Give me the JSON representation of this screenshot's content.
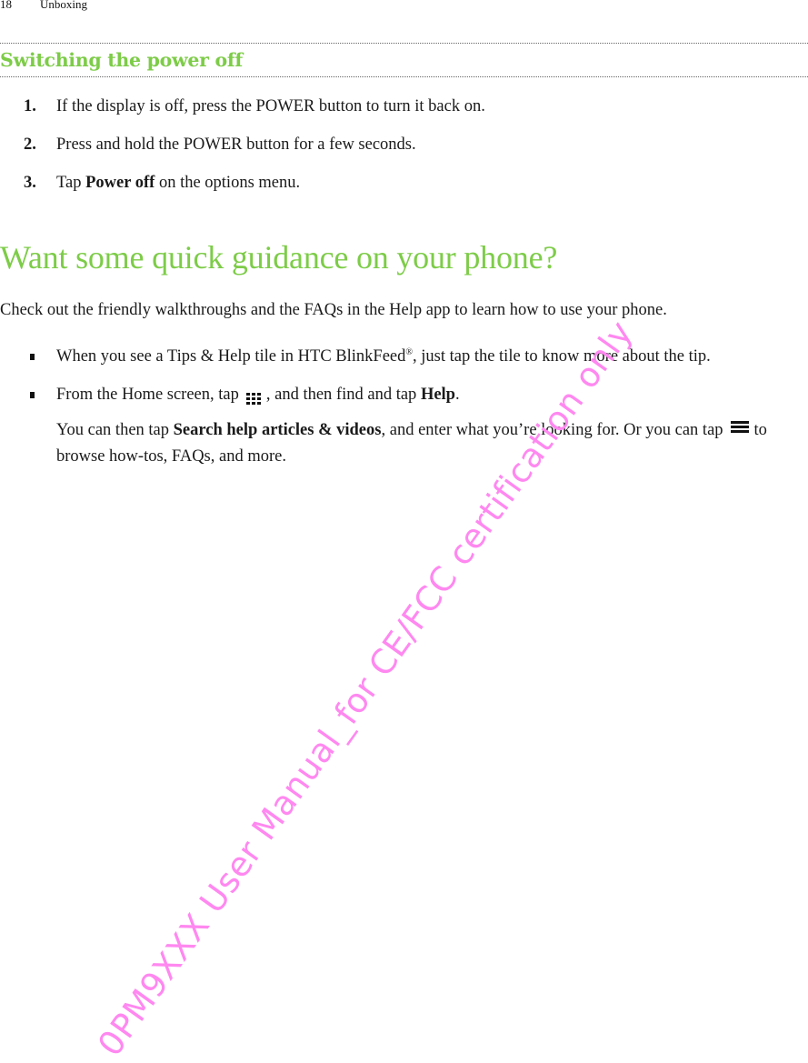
{
  "running_head": {
    "page_number": "18",
    "chapter": "Unboxing"
  },
  "section": {
    "title": "Switching the power off",
    "steps": [
      {
        "number": "1.",
        "text": "If the display is off, press the POWER button to turn it back on."
      },
      {
        "number": "2.",
        "text": "Press and hold the POWER button for a few seconds."
      },
      {
        "number": "3.",
        "text_before": "Tap ",
        "bold": "Power off",
        "text_after": " on the options menu."
      }
    ]
  },
  "guidance": {
    "title": "Want some quick guidance on your phone?",
    "intro": "Check out the friendly walkthroughs and the FAQs in the Help app to learn how to use your phone.",
    "bullets": [
      {
        "text_before": "When you see a Tips & Help tile in HTC BlinkFeed",
        "sup": "®",
        "text_after": ", just tap the tile to know more about the tip."
      },
      {
        "text_before": "From the Home screen, tap",
        "icon": "apps-grid-icon",
        "text_middle": ", and then find and tap ",
        "bold": "Help",
        "text_after": ".",
        "sub_para": {
          "text_before": "You can then tap ",
          "bold": "Search help articles & videos",
          "text_middle": ", and enter what you’re looking for. Or you can tap",
          "icon": "menu-icon",
          "text_after": "to browse how-tos, FAQs, and more."
        }
      }
    ]
  },
  "watermark": {
    "text": "0PM9XXX User Manual_for CE/FCC certification only",
    "color": "#ff88f0"
  },
  "colors": {
    "heading_green": "#7dcc48",
    "body_text": "#1a1a1a"
  }
}
